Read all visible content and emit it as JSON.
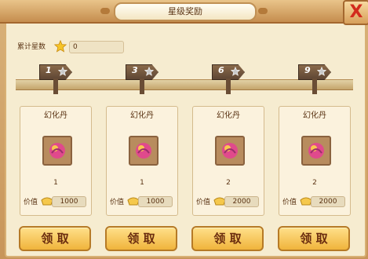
{
  "window": {
    "title": "星级奖励",
    "close_symbol": "X"
  },
  "stars": {
    "label": "累计星数",
    "value": "0",
    "icon": "star-icon"
  },
  "milestones": [
    {
      "stars_required": "1",
      "reward_name": "幻化丹",
      "count": "1",
      "value_label": "价值",
      "value": "1000",
      "claim_label": "领 取"
    },
    {
      "stars_required": "3",
      "reward_name": "幻化丹",
      "count": "1",
      "value_label": "价值",
      "value": "1000",
      "claim_label": "领 取"
    },
    {
      "stars_required": "6",
      "reward_name": "幻化丹",
      "count": "2",
      "value_label": "价值",
      "value": "2000",
      "claim_label": "领 取"
    },
    {
      "stars_required": "9",
      "reward_name": "幻化丹",
      "count": "2",
      "value_label": "价值",
      "value": "2000",
      "claim_label": "领 取"
    }
  ],
  "colors": {
    "panel_bg": "#f6ecd0",
    "button_bg": "#f0b43c",
    "close_x": "#d22a1d",
    "text_dark": "#5b3414"
  }
}
